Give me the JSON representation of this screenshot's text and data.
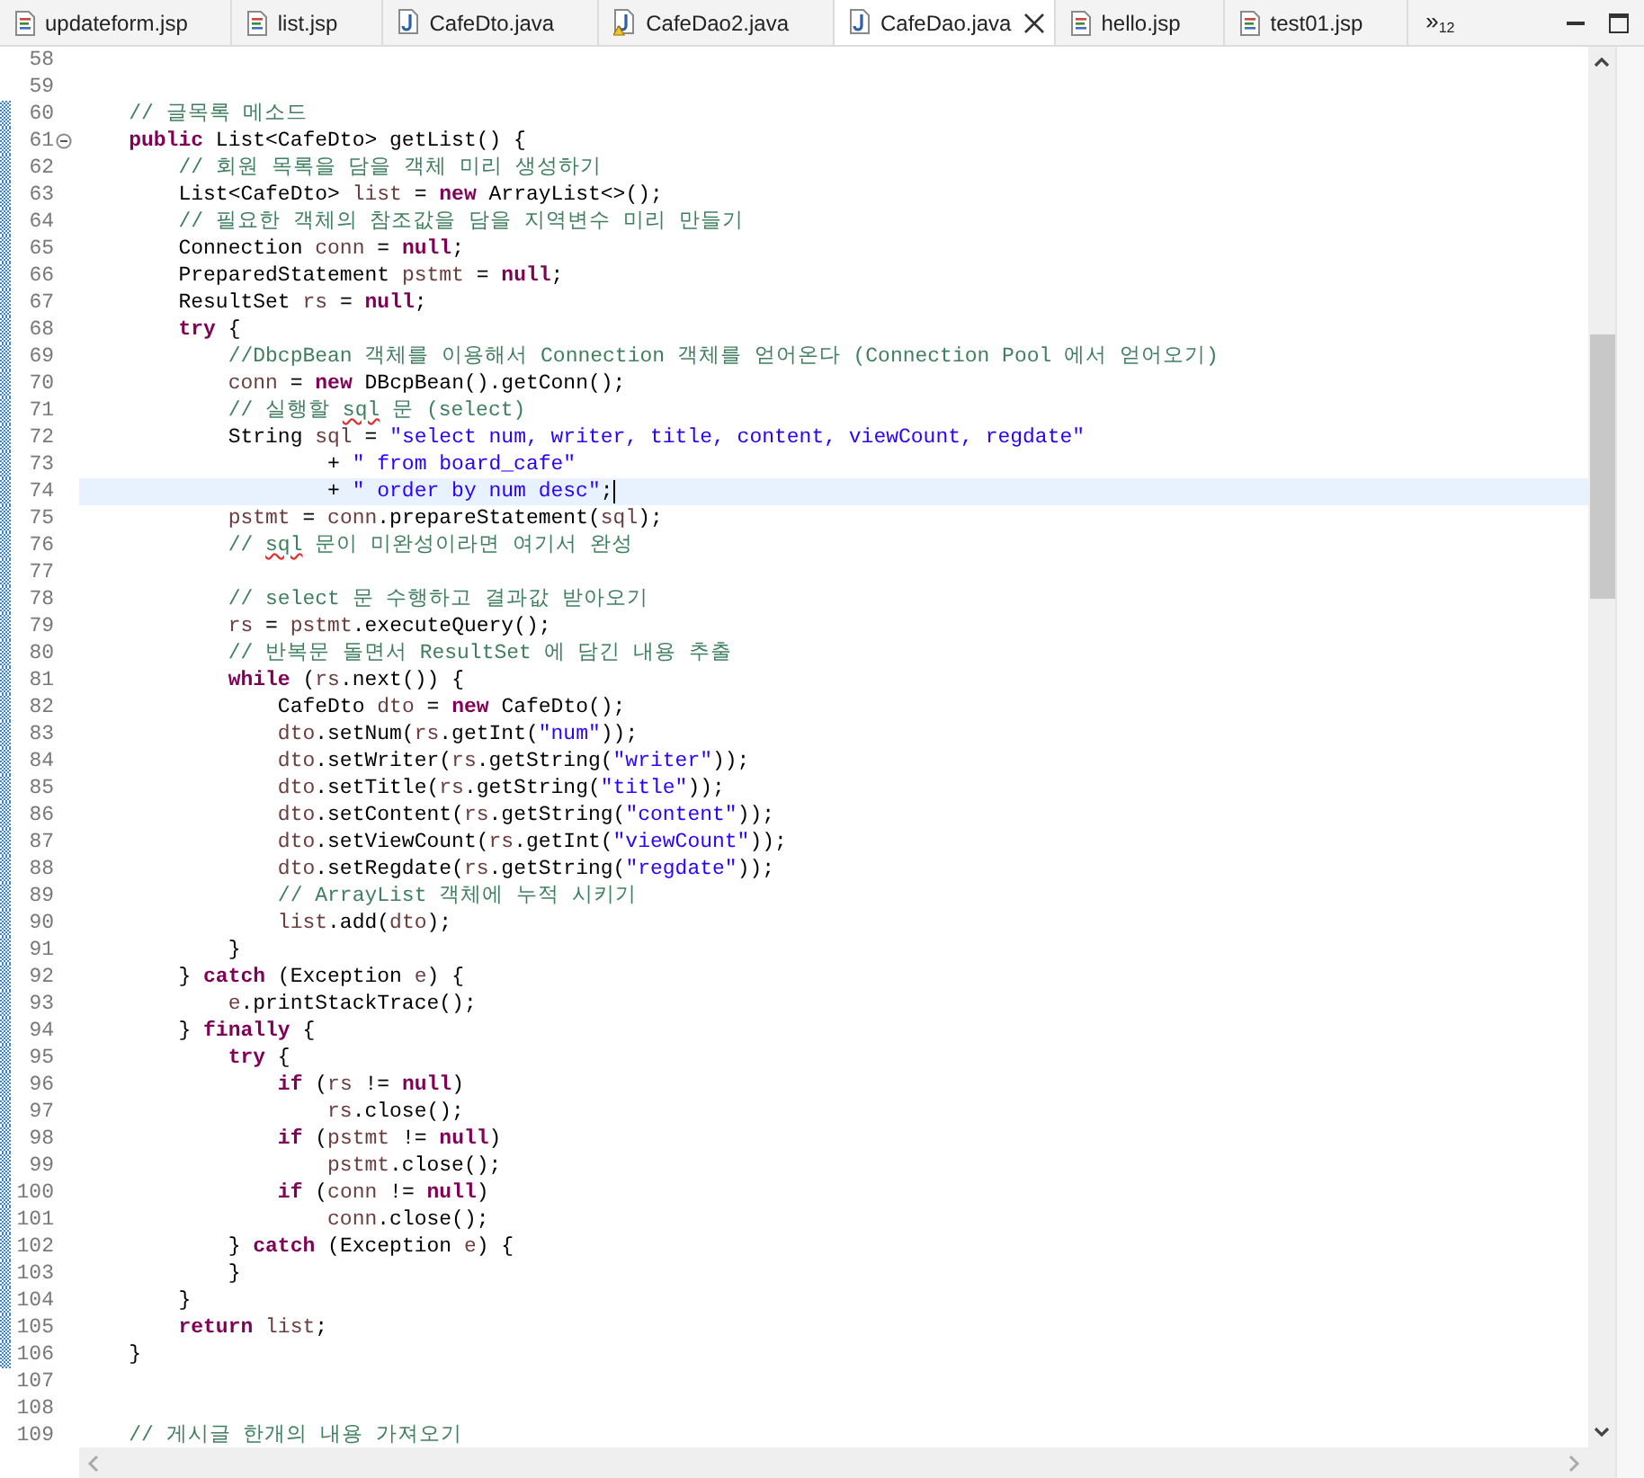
{
  "tabs": [
    {
      "label": "updateform.jsp",
      "kind": "jsp",
      "warning": false,
      "selected": false
    },
    {
      "label": "list.jsp",
      "kind": "jsp",
      "warning": false,
      "selected": false
    },
    {
      "label": "CafeDto.java",
      "kind": "java",
      "warning": false,
      "selected": false
    },
    {
      "label": "CafeDao2.java",
      "kind": "java",
      "warning": true,
      "selected": false
    },
    {
      "label": "CafeDao.java",
      "kind": "java",
      "warning": false,
      "selected": true
    },
    {
      "label": "hello.jsp",
      "kind": "jsp",
      "warning": false,
      "selected": false
    },
    {
      "label": "test01.jsp",
      "kind": "jsp",
      "warning": false,
      "selected": false
    }
  ],
  "overflow": {
    "symbol": "»",
    "count": "12"
  },
  "lines": [
    {
      "number": "58",
      "marked": false,
      "current": false,
      "foldable": false
    },
    {
      "number": "59",
      "marked": false,
      "current": false,
      "foldable": false
    },
    {
      "number": "60",
      "marked": true,
      "current": false,
      "foldable": false,
      "tokens": [
        {
          "kind": "comment",
          "text": "    // 글목록 메소드"
        }
      ]
    },
    {
      "number": "61",
      "marked": true,
      "current": false,
      "foldable": true,
      "tokens": [
        {
          "kind": "keyword",
          "text": "    public"
        },
        {
          "kind": "plain",
          "text": " List<CafeDto> getList() {"
        }
      ]
    },
    {
      "number": "62",
      "marked": true,
      "current": false,
      "foldable": false,
      "tokens": [
        {
          "kind": "comment",
          "text": "        // 회원 목록을 담을 객체 미리 생성하기"
        }
      ]
    },
    {
      "number": "63",
      "marked": true,
      "current": false,
      "foldable": false,
      "tokens": [
        {
          "kind": "plain",
          "text": "        List<CafeDto> "
        },
        {
          "kind": "local",
          "text": "list"
        },
        {
          "kind": "plain",
          "text": " = "
        },
        {
          "kind": "keyword",
          "text": "new"
        },
        {
          "kind": "plain",
          "text": " ArrayList<>();"
        }
      ]
    },
    {
      "number": "64",
      "marked": true,
      "current": false,
      "foldable": false,
      "tokens": [
        {
          "kind": "comment",
          "text": "        // 필요한 객체의 참조값을 담을 지역변수 미리 만들기"
        }
      ]
    },
    {
      "number": "65",
      "marked": true,
      "current": false,
      "foldable": false,
      "tokens": [
        {
          "kind": "plain",
          "text": "        Connection "
        },
        {
          "kind": "local",
          "text": "conn"
        },
        {
          "kind": "plain",
          "text": " = "
        },
        {
          "kind": "keyword",
          "text": "null"
        },
        {
          "kind": "plain",
          "text": ";"
        }
      ]
    },
    {
      "number": "66",
      "marked": true,
      "current": false,
      "foldable": false,
      "tokens": [
        {
          "kind": "plain",
          "text": "        PreparedStatement "
        },
        {
          "kind": "local",
          "text": "pstmt"
        },
        {
          "kind": "plain",
          "text": " = "
        },
        {
          "kind": "keyword",
          "text": "null"
        },
        {
          "kind": "plain",
          "text": ";"
        }
      ]
    },
    {
      "number": "67",
      "marked": true,
      "current": false,
      "foldable": false,
      "tokens": [
        {
          "kind": "plain",
          "text": "        ResultSet "
        },
        {
          "kind": "local",
          "text": "rs"
        },
        {
          "kind": "plain",
          "text": " = "
        },
        {
          "kind": "keyword",
          "text": "null"
        },
        {
          "kind": "plain",
          "text": ";"
        }
      ]
    },
    {
      "number": "68",
      "marked": true,
      "current": false,
      "foldable": false,
      "tokens": [
        {
          "kind": "keyword",
          "text": "        try"
        },
        {
          "kind": "plain",
          "text": " {"
        }
      ]
    },
    {
      "number": "69",
      "marked": true,
      "current": false,
      "foldable": false,
      "tokens": [
        {
          "kind": "comment",
          "text": "            //DbcpBean 객체를 이용해서 Connection 객체를 얻어온다 (Connection Pool 에서 얻어오기)"
        }
      ]
    },
    {
      "number": "70",
      "marked": true,
      "current": false,
      "foldable": false,
      "tokens": [
        {
          "kind": "local",
          "text": "            conn"
        },
        {
          "kind": "plain",
          "text": " = "
        },
        {
          "kind": "keyword",
          "text": "new"
        },
        {
          "kind": "plain",
          "text": " DBcpBean().getConn();"
        }
      ]
    },
    {
      "number": "71",
      "marked": true,
      "current": false,
      "foldable": false,
      "tokens": [
        {
          "kind": "comment",
          "text": "            // 실행할 "
        },
        {
          "kind": "misspelled",
          "text": "sql"
        },
        {
          "kind": "comment",
          "text": " 문 (select)"
        }
      ]
    },
    {
      "number": "72",
      "marked": true,
      "current": false,
      "foldable": false,
      "tokens": [
        {
          "kind": "plain",
          "text": "            String "
        },
        {
          "kind": "local",
          "text": "sql"
        },
        {
          "kind": "plain",
          "text": " = "
        },
        {
          "kind": "string",
          "text": "\"select num, writer, title, content, viewCount, regdate\""
        }
      ]
    },
    {
      "number": "73",
      "marked": true,
      "current": false,
      "foldable": false,
      "tokens": [
        {
          "kind": "plain",
          "text": "                    + "
        },
        {
          "kind": "string",
          "text": "\" from board_cafe\""
        }
      ]
    },
    {
      "number": "74",
      "marked": true,
      "current": true,
      "foldable": false,
      "tokens": [
        {
          "kind": "plain",
          "text": "                    + "
        },
        {
          "kind": "string",
          "text": "\" order by num desc\""
        },
        {
          "kind": "plain",
          "text": ";"
        }
      ]
    },
    {
      "number": "75",
      "marked": true,
      "current": false,
      "foldable": false,
      "tokens": [
        {
          "kind": "local",
          "text": "            pstmt"
        },
        {
          "kind": "plain",
          "text": " = "
        },
        {
          "kind": "local",
          "text": "conn"
        },
        {
          "kind": "plain",
          "text": ".prepareStatement("
        },
        {
          "kind": "local",
          "text": "sql"
        },
        {
          "kind": "plain",
          "text": ");"
        }
      ]
    },
    {
      "number": "76",
      "marked": true,
      "current": false,
      "foldable": false,
      "tokens": [
        {
          "kind": "comment",
          "text": "            // "
        },
        {
          "kind": "misspelled",
          "text": "sql"
        },
        {
          "kind": "comment",
          "text": " 문이 미완성이라면 여기서 완성"
        }
      ]
    },
    {
      "number": "77",
      "marked": true,
      "current": false,
      "foldable": false
    },
    {
      "number": "78",
      "marked": true,
      "current": false,
      "foldable": false,
      "tokens": [
        {
          "kind": "comment",
          "text": "            // select 문 수행하고 결과값 받아오기"
        }
      ]
    },
    {
      "number": "79",
      "marked": true,
      "current": false,
      "foldable": false,
      "tokens": [
        {
          "kind": "local",
          "text": "            rs"
        },
        {
          "kind": "plain",
          "text": " = "
        },
        {
          "kind": "local",
          "text": "pstmt"
        },
        {
          "kind": "plain",
          "text": ".executeQuery();"
        }
      ]
    },
    {
      "number": "80",
      "marked": true,
      "current": false,
      "foldable": false,
      "tokens": [
        {
          "kind": "comment",
          "text": "            // 반복문 돌면서 ResultSet 에 담긴 내용 추출"
        }
      ]
    },
    {
      "number": "81",
      "marked": true,
      "current": false,
      "foldable": false,
      "tokens": [
        {
          "kind": "keyword",
          "text": "            while"
        },
        {
          "kind": "plain",
          "text": " ("
        },
        {
          "kind": "local",
          "text": "rs"
        },
        {
          "kind": "plain",
          "text": ".next()) {"
        }
      ]
    },
    {
      "number": "82",
      "marked": true,
      "current": false,
      "foldable": false,
      "tokens": [
        {
          "kind": "plain",
          "text": "                CafeDto "
        },
        {
          "kind": "local",
          "text": "dto"
        },
        {
          "kind": "plain",
          "text": " = "
        },
        {
          "kind": "keyword",
          "text": "new"
        },
        {
          "kind": "plain",
          "text": " CafeDto();"
        }
      ]
    },
    {
      "number": "83",
      "marked": true,
      "current": false,
      "foldable": false,
      "tokens": [
        {
          "kind": "local",
          "text": "                dto"
        },
        {
          "kind": "plain",
          "text": ".setNum("
        },
        {
          "kind": "local",
          "text": "rs"
        },
        {
          "kind": "plain",
          "text": ".getInt("
        },
        {
          "kind": "string",
          "text": "\"num\""
        },
        {
          "kind": "plain",
          "text": "));"
        }
      ]
    },
    {
      "number": "84",
      "marked": true,
      "current": false,
      "foldable": false,
      "tokens": [
        {
          "kind": "local",
          "text": "                dto"
        },
        {
          "kind": "plain",
          "text": ".setWriter("
        },
        {
          "kind": "local",
          "text": "rs"
        },
        {
          "kind": "plain",
          "text": ".getString("
        },
        {
          "kind": "string",
          "text": "\"writer\""
        },
        {
          "kind": "plain",
          "text": "));"
        }
      ]
    },
    {
      "number": "85",
      "marked": true,
      "current": false,
      "foldable": false,
      "tokens": [
        {
          "kind": "local",
          "text": "                dto"
        },
        {
          "kind": "plain",
          "text": ".setTitle("
        },
        {
          "kind": "local",
          "text": "rs"
        },
        {
          "kind": "plain",
          "text": ".getString("
        },
        {
          "kind": "string",
          "text": "\"title\""
        },
        {
          "kind": "plain",
          "text": "));"
        }
      ]
    },
    {
      "number": "86",
      "marked": true,
      "current": false,
      "foldable": false,
      "tokens": [
        {
          "kind": "local",
          "text": "                dto"
        },
        {
          "kind": "plain",
          "text": ".setContent("
        },
        {
          "kind": "local",
          "text": "rs"
        },
        {
          "kind": "plain",
          "text": ".getString("
        },
        {
          "kind": "string",
          "text": "\"content\""
        },
        {
          "kind": "plain",
          "text": "));"
        }
      ]
    },
    {
      "number": "87",
      "marked": true,
      "current": false,
      "foldable": false,
      "tokens": [
        {
          "kind": "local",
          "text": "                dto"
        },
        {
          "kind": "plain",
          "text": ".setViewCount("
        },
        {
          "kind": "local",
          "text": "rs"
        },
        {
          "kind": "plain",
          "text": ".getInt("
        },
        {
          "kind": "string",
          "text": "\"viewCount\""
        },
        {
          "kind": "plain",
          "text": "));"
        }
      ]
    },
    {
      "number": "88",
      "marked": true,
      "current": false,
      "foldable": false,
      "tokens": [
        {
          "kind": "local",
          "text": "                dto"
        },
        {
          "kind": "plain",
          "text": ".setRegdate("
        },
        {
          "kind": "local",
          "text": "rs"
        },
        {
          "kind": "plain",
          "text": ".getString("
        },
        {
          "kind": "string",
          "text": "\"regdate\""
        },
        {
          "kind": "plain",
          "text": "));"
        }
      ]
    },
    {
      "number": "89",
      "marked": true,
      "current": false,
      "foldable": false,
      "tokens": [
        {
          "kind": "comment",
          "text": "                // ArrayList 객체에 누적 시키기"
        }
      ]
    },
    {
      "number": "90",
      "marked": true,
      "current": false,
      "foldable": false,
      "tokens": [
        {
          "kind": "local",
          "text": "                list"
        },
        {
          "kind": "plain",
          "text": ".add("
        },
        {
          "kind": "local",
          "text": "dto"
        },
        {
          "kind": "plain",
          "text": ");"
        }
      ]
    },
    {
      "number": "91",
      "marked": true,
      "current": false,
      "foldable": false,
      "tokens": [
        {
          "kind": "plain",
          "text": "            }"
        }
      ]
    },
    {
      "number": "92",
      "marked": true,
      "current": false,
      "foldable": false,
      "tokens": [
        {
          "kind": "plain",
          "text": "        } "
        },
        {
          "kind": "keyword",
          "text": "catch"
        },
        {
          "kind": "plain",
          "text": " (Exception "
        },
        {
          "kind": "local",
          "text": "e"
        },
        {
          "kind": "plain",
          "text": ") {"
        }
      ]
    },
    {
      "number": "93",
      "marked": true,
      "current": false,
      "foldable": false,
      "tokens": [
        {
          "kind": "local",
          "text": "            e"
        },
        {
          "kind": "plain",
          "text": ".printStackTrace();"
        }
      ]
    },
    {
      "number": "94",
      "marked": true,
      "current": false,
      "foldable": false,
      "tokens": [
        {
          "kind": "plain",
          "text": "        } "
        },
        {
          "kind": "keyword",
          "text": "finally"
        },
        {
          "kind": "plain",
          "text": " {"
        }
      ]
    },
    {
      "number": "95",
      "marked": true,
      "current": false,
      "foldable": false,
      "tokens": [
        {
          "kind": "keyword",
          "text": "            try"
        },
        {
          "kind": "plain",
          "text": " {"
        }
      ]
    },
    {
      "number": "96",
      "marked": true,
      "current": false,
      "foldable": false,
      "tokens": [
        {
          "kind": "keyword",
          "text": "                if"
        },
        {
          "kind": "plain",
          "text": " ("
        },
        {
          "kind": "local",
          "text": "rs"
        },
        {
          "kind": "plain",
          "text": " != "
        },
        {
          "kind": "keyword",
          "text": "null"
        },
        {
          "kind": "plain",
          "text": ")"
        }
      ]
    },
    {
      "number": "97",
      "marked": true,
      "current": false,
      "foldable": false,
      "tokens": [
        {
          "kind": "local",
          "text": "                    rs"
        },
        {
          "kind": "plain",
          "text": ".close();"
        }
      ]
    },
    {
      "number": "98",
      "marked": true,
      "current": false,
      "foldable": false,
      "tokens": [
        {
          "kind": "keyword",
          "text": "                if"
        },
        {
          "kind": "plain",
          "text": " ("
        },
        {
          "kind": "local",
          "text": "pstmt"
        },
        {
          "kind": "plain",
          "text": " != "
        },
        {
          "kind": "keyword",
          "text": "null"
        },
        {
          "kind": "plain",
          "text": ")"
        }
      ]
    },
    {
      "number": "99",
      "marked": true,
      "current": false,
      "foldable": false,
      "tokens": [
        {
          "kind": "local",
          "text": "                    pstmt"
        },
        {
          "kind": "plain",
          "text": ".close();"
        }
      ]
    },
    {
      "number": "100",
      "marked": true,
      "current": false,
      "foldable": false,
      "tokens": [
        {
          "kind": "keyword",
          "text": "                if"
        },
        {
          "kind": "plain",
          "text": " ("
        },
        {
          "kind": "local",
          "text": "conn"
        },
        {
          "kind": "plain",
          "text": " != "
        },
        {
          "kind": "keyword",
          "text": "null"
        },
        {
          "kind": "plain",
          "text": ")"
        }
      ]
    },
    {
      "number": "101",
      "marked": true,
      "current": false,
      "foldable": false,
      "tokens": [
        {
          "kind": "local",
          "text": "                    conn"
        },
        {
          "kind": "plain",
          "text": ".close();"
        }
      ]
    },
    {
      "number": "102",
      "marked": true,
      "current": false,
      "foldable": false,
      "tokens": [
        {
          "kind": "plain",
          "text": "            } "
        },
        {
          "kind": "keyword",
          "text": "catch"
        },
        {
          "kind": "plain",
          "text": " (Exception "
        },
        {
          "kind": "local",
          "text": "e"
        },
        {
          "kind": "plain",
          "text": ") {"
        }
      ]
    },
    {
      "number": "103",
      "marked": true,
      "current": false,
      "foldable": false,
      "tokens": [
        {
          "kind": "plain",
          "text": "            }"
        }
      ]
    },
    {
      "number": "104",
      "marked": true,
      "current": false,
      "foldable": false,
      "tokens": [
        {
          "kind": "plain",
          "text": "        }"
        }
      ]
    },
    {
      "number": "105",
      "marked": true,
      "current": false,
      "foldable": false,
      "tokens": [
        {
          "kind": "keyword",
          "text": "        return"
        },
        {
          "kind": "local",
          "text": " list"
        },
        {
          "kind": "plain",
          "text": ";"
        }
      ]
    },
    {
      "number": "106",
      "marked": true,
      "current": false,
      "foldable": false,
      "tokens": [
        {
          "kind": "plain",
          "text": "    }"
        }
      ]
    },
    {
      "number": "107",
      "marked": false,
      "current": false,
      "foldable": false
    },
    {
      "number": "108",
      "marked": false,
      "current": false,
      "foldable": false
    },
    {
      "number": "109",
      "marked": false,
      "current": false,
      "foldable": false,
      "tokens": [
        {
          "kind": "comment",
          "text": "    // 게시글 한개의 내용 가져오기"
        }
      ]
    }
  ]
}
